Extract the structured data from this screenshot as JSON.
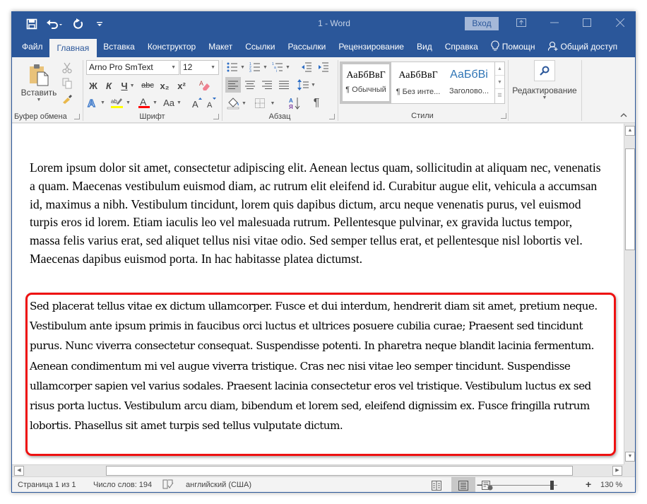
{
  "titlebar": {
    "title": "1  -  Word",
    "signin_label": "Вход",
    "qat_icons": [
      "save-icon",
      "undo-icon",
      "redo-icon",
      "customize-qat-icon"
    ]
  },
  "tabs": [
    {
      "label": "Файл",
      "active": false
    },
    {
      "label": "Главная",
      "active": true
    },
    {
      "label": "Вставка",
      "active": false
    },
    {
      "label": "Конструктор",
      "active": false
    },
    {
      "label": "Макет",
      "active": false
    },
    {
      "label": "Ссылки",
      "active": false
    },
    {
      "label": "Рассылки",
      "active": false
    },
    {
      "label": "Рецензирование",
      "active": false
    },
    {
      "label": "Вид",
      "active": false
    },
    {
      "label": "Справка",
      "active": false
    },
    {
      "label": "Помощн",
      "active": false,
      "icon": "lightbulb-icon"
    },
    {
      "label": "Общий доступ",
      "active": false,
      "icon": "share-person-icon"
    }
  ],
  "ribbon": {
    "clipboard": {
      "label": "Буфер обмена",
      "paste_label": "Вставить"
    },
    "font": {
      "label": "Шрифт",
      "font_name": "Arno Pro SmText",
      "font_size": "12",
      "bold": "Ж",
      "italic": "К",
      "underline": "Ч",
      "strike": "abc",
      "subscript": "x₂",
      "superscript": "x²",
      "change_case": "Aa",
      "highlight_color": "#ffff00",
      "font_color": "#ff0000"
    },
    "paragraph": {
      "label": "Абзац"
    },
    "styles": {
      "label": "Стили",
      "items": [
        {
          "sample": "АаБбВвГ",
          "name": "¶ Обычный",
          "selected": true
        },
        {
          "sample": "АаБбВвГ",
          "name": "¶ Без инте...",
          "selected": false
        },
        {
          "sample": "АаБбВі",
          "name": "Заголово...",
          "selected": false
        }
      ]
    },
    "editing": {
      "label": "Редактирование"
    }
  },
  "document": {
    "paragraph1": "Lorem ipsum dolor sit amet, consectetur adipiscing elit. Aenean lectus quam, sollicitudin at aliquam nec, venenatis a quam. Maecenas vestibulum euismod diam, ac rutrum elit eleifend id. Curabitur augue elit, vehicula a accumsan id, maximus a nibh. Vestibulum tincidunt, lorem quis dapibus dictum, arcu neque venenatis purus, vel euismod turpis eros id lorem. Etiam iaculis leo vel malesuada rutrum. Pellentesque pulvinar, ex gravida luctus tempor, massa felis varius erat, sed aliquet tellus nisi vitae odio. Sed semper tellus erat, et pellentesque nisl lobortis vel. Maecenas dapibus euismod porta. In hac habitasse platea dictumst.",
    "paragraph2": "Sed placerat tellus vitae ex dictum ullamcorper. Fusce et dui interdum, hendrerit diam sit amet, pretium neque. Vestibulum ante ipsum primis in faucibus orci luctus et ultrices posuere cubilia curae; Praesent sed tincidunt purus. Nunc viverra consectetur consequat. Suspendisse potenti. In pharetra neque blandit lacinia fermentum. Aenean condimentum mi vel augue viverra tristique. Cras nec nisi vitae leo semper tincidunt. Suspendisse ullamcorper sapien vel varius sodales. Praesent lacinia consectetur eros vel tristique. Vestibulum luctus ex sed risus porta luctus. Vestibulum arcu diam, bibendum et lorem sed, eleifend dignissim ex. Fusce fringilla rutrum lobortis. Phasellus sit amet turpis sed tellus vulputate dictum.",
    "highlight_color": "#ee1111"
  },
  "statusbar": {
    "page": "Страница 1 из 1",
    "word_count": "Число слов: 194",
    "language": "английский (США)",
    "zoom": "130 %",
    "zoom_percent": 130,
    "active_view": "print-layout"
  },
  "colors": {
    "accent": "#2b579a"
  }
}
